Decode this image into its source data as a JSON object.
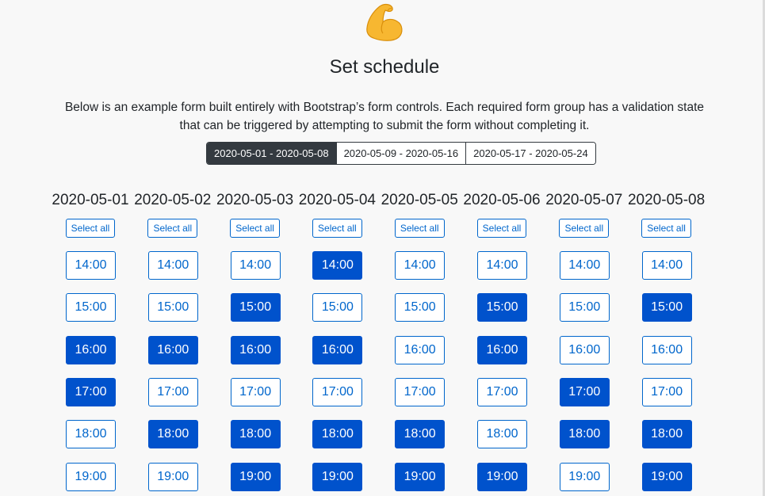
{
  "hero_icon": "flexed-biceps-icon",
  "title": "Set schedule",
  "description": "Below is an example form built entirely with Bootstrap’s form controls. Each required form group has a validation state that can be triggered by attempting to submit the form without completing it.",
  "colors": {
    "accent": "#0066cc",
    "selected": "#0052cc",
    "active_tab": "#343a40"
  },
  "weeks": [
    {
      "label": "2020-05-01 - 2020-05-08",
      "active": true
    },
    {
      "label": "2020-05-09 - 2020-05-16",
      "active": false
    },
    {
      "label": "2020-05-17 - 2020-05-24",
      "active": false
    }
  ],
  "select_all_label": "Select all",
  "days": [
    {
      "date": "2020-05-01",
      "slots": [
        {
          "time": "14:00",
          "selected": false
        },
        {
          "time": "15:00",
          "selected": false
        },
        {
          "time": "16:00",
          "selected": true
        },
        {
          "time": "17:00",
          "selected": true
        },
        {
          "time": "18:00",
          "selected": false
        },
        {
          "time": "19:00",
          "selected": false
        }
      ]
    },
    {
      "date": "2020-05-02",
      "slots": [
        {
          "time": "14:00",
          "selected": false
        },
        {
          "time": "15:00",
          "selected": false
        },
        {
          "time": "16:00",
          "selected": true
        },
        {
          "time": "17:00",
          "selected": false
        },
        {
          "time": "18:00",
          "selected": true
        },
        {
          "time": "19:00",
          "selected": false
        }
      ]
    },
    {
      "date": "2020-05-03",
      "slots": [
        {
          "time": "14:00",
          "selected": false
        },
        {
          "time": "15:00",
          "selected": true
        },
        {
          "time": "16:00",
          "selected": true
        },
        {
          "time": "17:00",
          "selected": false
        },
        {
          "time": "18:00",
          "selected": true
        },
        {
          "time": "19:00",
          "selected": true
        }
      ]
    },
    {
      "date": "2020-05-04",
      "slots": [
        {
          "time": "14:00",
          "selected": true
        },
        {
          "time": "15:00",
          "selected": false
        },
        {
          "time": "16:00",
          "selected": true
        },
        {
          "time": "17:00",
          "selected": false
        },
        {
          "time": "18:00",
          "selected": true
        },
        {
          "time": "19:00",
          "selected": true
        }
      ]
    },
    {
      "date": "2020-05-05",
      "slots": [
        {
          "time": "14:00",
          "selected": false
        },
        {
          "time": "15:00",
          "selected": false
        },
        {
          "time": "16:00",
          "selected": false
        },
        {
          "time": "17:00",
          "selected": false
        },
        {
          "time": "18:00",
          "selected": true
        },
        {
          "time": "19:00",
          "selected": true
        }
      ]
    },
    {
      "date": "2020-05-06",
      "slots": [
        {
          "time": "14:00",
          "selected": false
        },
        {
          "time": "15:00",
          "selected": true
        },
        {
          "time": "16:00",
          "selected": true
        },
        {
          "time": "17:00",
          "selected": false
        },
        {
          "time": "18:00",
          "selected": false
        },
        {
          "time": "19:00",
          "selected": true
        }
      ]
    },
    {
      "date": "2020-05-07",
      "slots": [
        {
          "time": "14:00",
          "selected": false
        },
        {
          "time": "15:00",
          "selected": false
        },
        {
          "time": "16:00",
          "selected": false
        },
        {
          "time": "17:00",
          "selected": true
        },
        {
          "time": "18:00",
          "selected": true
        },
        {
          "time": "19:00",
          "selected": false
        }
      ]
    },
    {
      "date": "2020-05-08",
      "slots": [
        {
          "time": "14:00",
          "selected": false
        },
        {
          "time": "15:00",
          "selected": true
        },
        {
          "time": "16:00",
          "selected": false
        },
        {
          "time": "17:00",
          "selected": false
        },
        {
          "time": "18:00",
          "selected": true
        },
        {
          "time": "19:00",
          "selected": true
        }
      ]
    }
  ]
}
